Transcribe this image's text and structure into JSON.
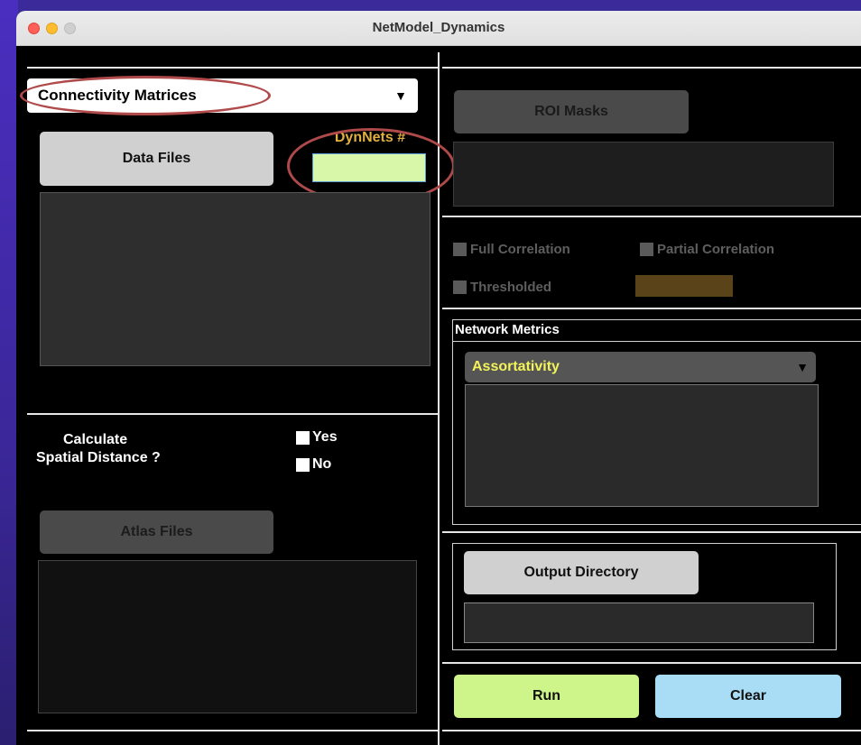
{
  "window": {
    "title": "NetModel_Dynamics"
  },
  "left": {
    "input_type_dropdown": {
      "selected": "Connectivity Matrices"
    },
    "data_files_button": "Data Files",
    "dynnets_label": "DynNets #",
    "dynnets_value": "",
    "spatial": {
      "label_line1": "Calculate",
      "label_line2": "Spatial Distance ?",
      "yes_label": "Yes",
      "no_label": "No"
    },
    "atlas_files_button": "Atlas Files"
  },
  "right": {
    "roi_masks_button": "ROI Masks",
    "full_correlation_label": "Full Correlation",
    "partial_correlation_label": "Partial Correlation",
    "thresholded_label": "Thresholded",
    "network_metrics": {
      "title": "Network Metrics",
      "selected_metric": "Assortativity"
    },
    "output_directory_button": "Output Directory",
    "run_button": "Run",
    "clear_button": "Clear"
  },
  "colors": {
    "dynnets_label": "#e0b040",
    "dynnets_input": "#d8f7a8",
    "metric_dropdown_text": "#f3f35a",
    "run_button": "#cdf58a",
    "clear_button": "#a9ddf5",
    "annotation_ring": "#b04a4a",
    "threshold_field": "#5a4318"
  }
}
